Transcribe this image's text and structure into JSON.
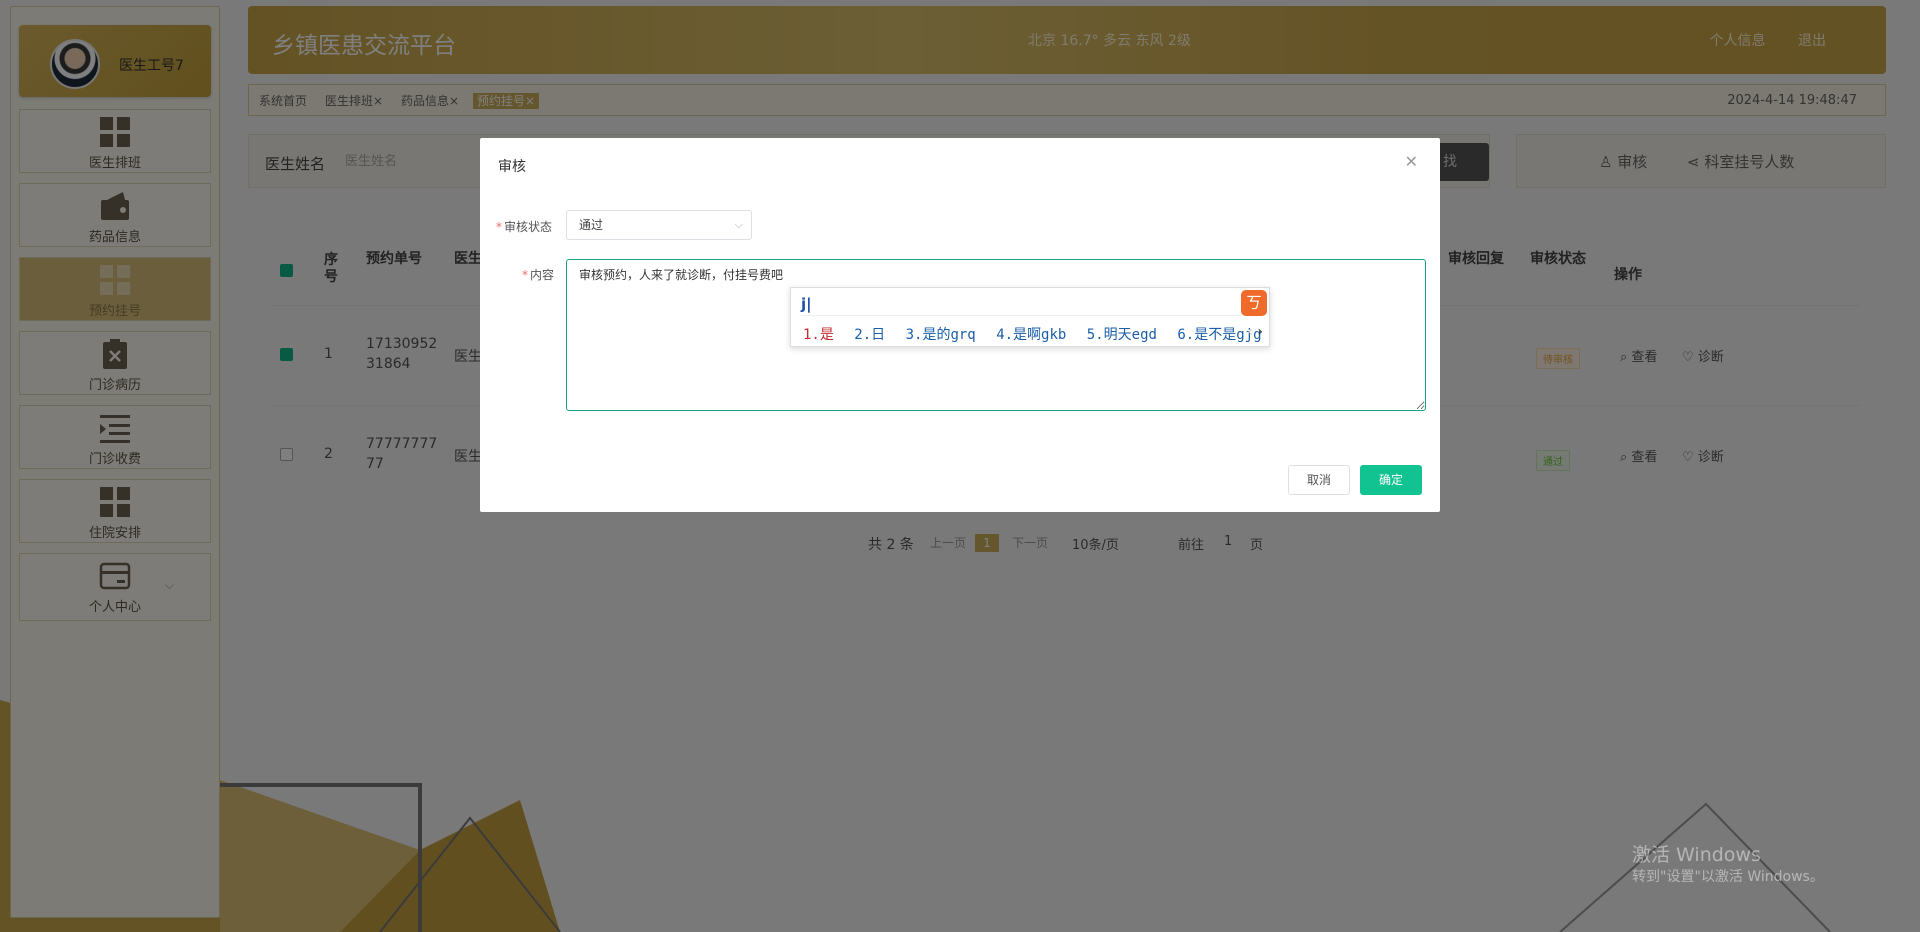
{
  "sidebar": {
    "user_name": "医生工号7",
    "items": [
      {
        "label": "医生排班",
        "icon": "grid-icon"
      },
      {
        "label": "药品信息",
        "icon": "wallet-icon"
      },
      {
        "label": "预约挂号",
        "icon": "grid-icon"
      },
      {
        "label": "门诊病历",
        "icon": "clipboard-x-icon"
      },
      {
        "label": "门诊收费",
        "icon": "list-indent-icon"
      },
      {
        "label": "住院安排",
        "icon": "grid-icon"
      },
      {
        "label": "个人中心",
        "icon": "card-icon"
      }
    ]
  },
  "header": {
    "title": "乡镇医患交流平台",
    "weather": "北京 16.7° 多云 东风 2级",
    "profile_link": "个人信息",
    "logout_link": "退出"
  },
  "tags": {
    "items": [
      "系统首页",
      "医生排班",
      "药品信息",
      "预约挂号"
    ],
    "close": "×",
    "time": "2024-4-14 19:48:47"
  },
  "search": {
    "label": "医生姓名",
    "placeholder": "医生姓名",
    "btn_partial": "找"
  },
  "actions": {
    "review": "审核",
    "dept_count": "科室挂号人数"
  },
  "table": {
    "headers": {
      "seq": "序号",
      "order_no": "预约单号",
      "doctor": "医生",
      "review_reply": "审核回复",
      "review_status": "审核状态",
      "ops": "操作"
    },
    "rows": [
      {
        "seq": "1",
        "order_no_1": "17130952",
        "order_no_2": "31864",
        "doctor": "医生",
        "status": "待审核",
        "view": "查看",
        "diagnose": "诊断"
      },
      {
        "seq": "2",
        "order_no_1": "77777777",
        "order_no_2": "77",
        "doctor": "医生",
        "status": "通过",
        "view": "查看",
        "diagnose": "诊断"
      }
    ]
  },
  "pager": {
    "total": "共 2 条",
    "prev": "上一页",
    "page": "1",
    "next": "下一页",
    "size": "10条/页",
    "goto": "前往",
    "goto_page": "1",
    "page_unit": "页"
  },
  "dialog": {
    "title": "审核",
    "status_label": "审核状态",
    "status_value": "通过",
    "content_label": "内容",
    "content_value": "审核预约，人来了就诊断，付挂号费吧",
    "cancel": "取消",
    "ok": "确定"
  },
  "ime": {
    "composition": "j",
    "candidates": [
      "1.是",
      "2.日",
      "3.是的grq",
      "4.是啊gkb",
      "5.明天egd",
      "6.是不是gjg"
    ]
  },
  "watermark": {
    "line1": "激活 Windows",
    "line2": "转到\"设置\"以激活 Windows。"
  },
  "colors": {
    "accent": "#c7a448",
    "primary_button": "#12c392",
    "mask": "rgba(0,0,0,0.5)"
  }
}
